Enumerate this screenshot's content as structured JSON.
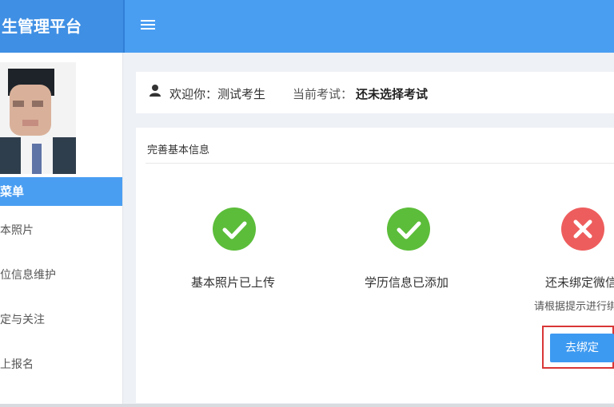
{
  "app": {
    "title": "生管理平台"
  },
  "sidebar": {
    "header": "菜单",
    "items": [
      {
        "label": "本照片"
      },
      {
        "label": "位信息维护"
      },
      {
        "label": "定与关注"
      },
      {
        "label": "上报名"
      }
    ]
  },
  "info_bar": {
    "welcome": "欢迎你：测试考生",
    "exam_label": "当前考试：",
    "exam_value": "还未选择考试"
  },
  "panel": {
    "title": "完善基本信息",
    "steps": [
      {
        "status": "done",
        "icon": "checkmark-icon",
        "text": "基本照片已上传"
      },
      {
        "status": "done",
        "icon": "checkmark-icon",
        "text": "学历信息已添加"
      },
      {
        "status": "pending",
        "icon": "close-icon",
        "text": "还未绑定微信",
        "hint": "请根据提示进行绑"
      }
    ],
    "bind_button": "去绑定"
  },
  "colors": {
    "primary": "#4a9ef2",
    "success": "#5cbd3a",
    "danger": "#ee5d5d",
    "highlight": "#d93636"
  }
}
